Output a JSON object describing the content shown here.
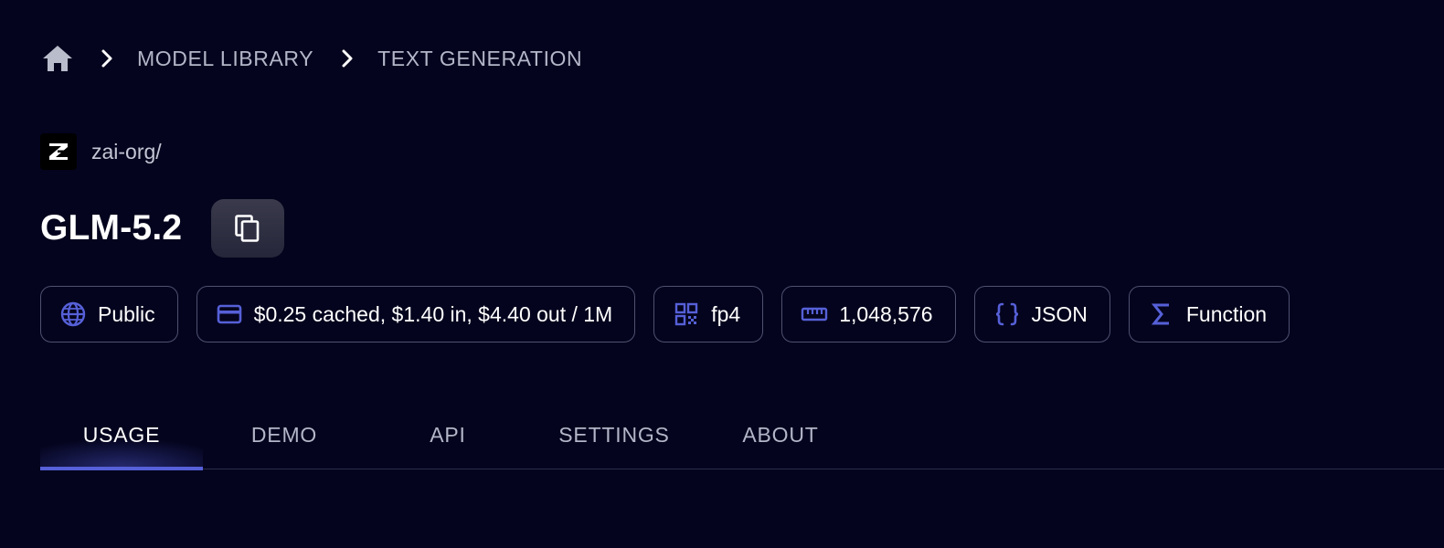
{
  "breadcrumb": {
    "home_icon": "home-icon",
    "separator_icon": "chevron-right-icon",
    "items": [
      "MODEL LIBRARY",
      "TEXT GENERATION"
    ]
  },
  "org": {
    "logo_icon": "zai-logo",
    "name": "zai-org/"
  },
  "model": {
    "title": "GLM-5.2",
    "copy_icon": "copy-icon"
  },
  "chips": [
    {
      "icon": "globe-icon",
      "label": "Public"
    },
    {
      "icon": "credit-card-icon",
      "label": "$0.25 cached, $1.40 in, $4.40 out / 1M"
    },
    {
      "icon": "qr-code-icon",
      "label": "fp4"
    },
    {
      "icon": "ruler-icon",
      "label": "1,048,576"
    },
    {
      "icon": "braces-icon",
      "label": "JSON"
    },
    {
      "icon": "sigma-icon",
      "label": "Function"
    }
  ],
  "tabs": {
    "active": "USAGE",
    "items": [
      {
        "label": "USAGE"
      },
      {
        "label": "DEMO"
      },
      {
        "label": "API"
      },
      {
        "label": "SETTINGS"
      },
      {
        "label": "ABOUT"
      }
    ]
  },
  "colors": {
    "background": "#04041e",
    "accent": "#5660d8",
    "chip_border": "#4f5170",
    "muted_text": "#b3b6c8"
  }
}
